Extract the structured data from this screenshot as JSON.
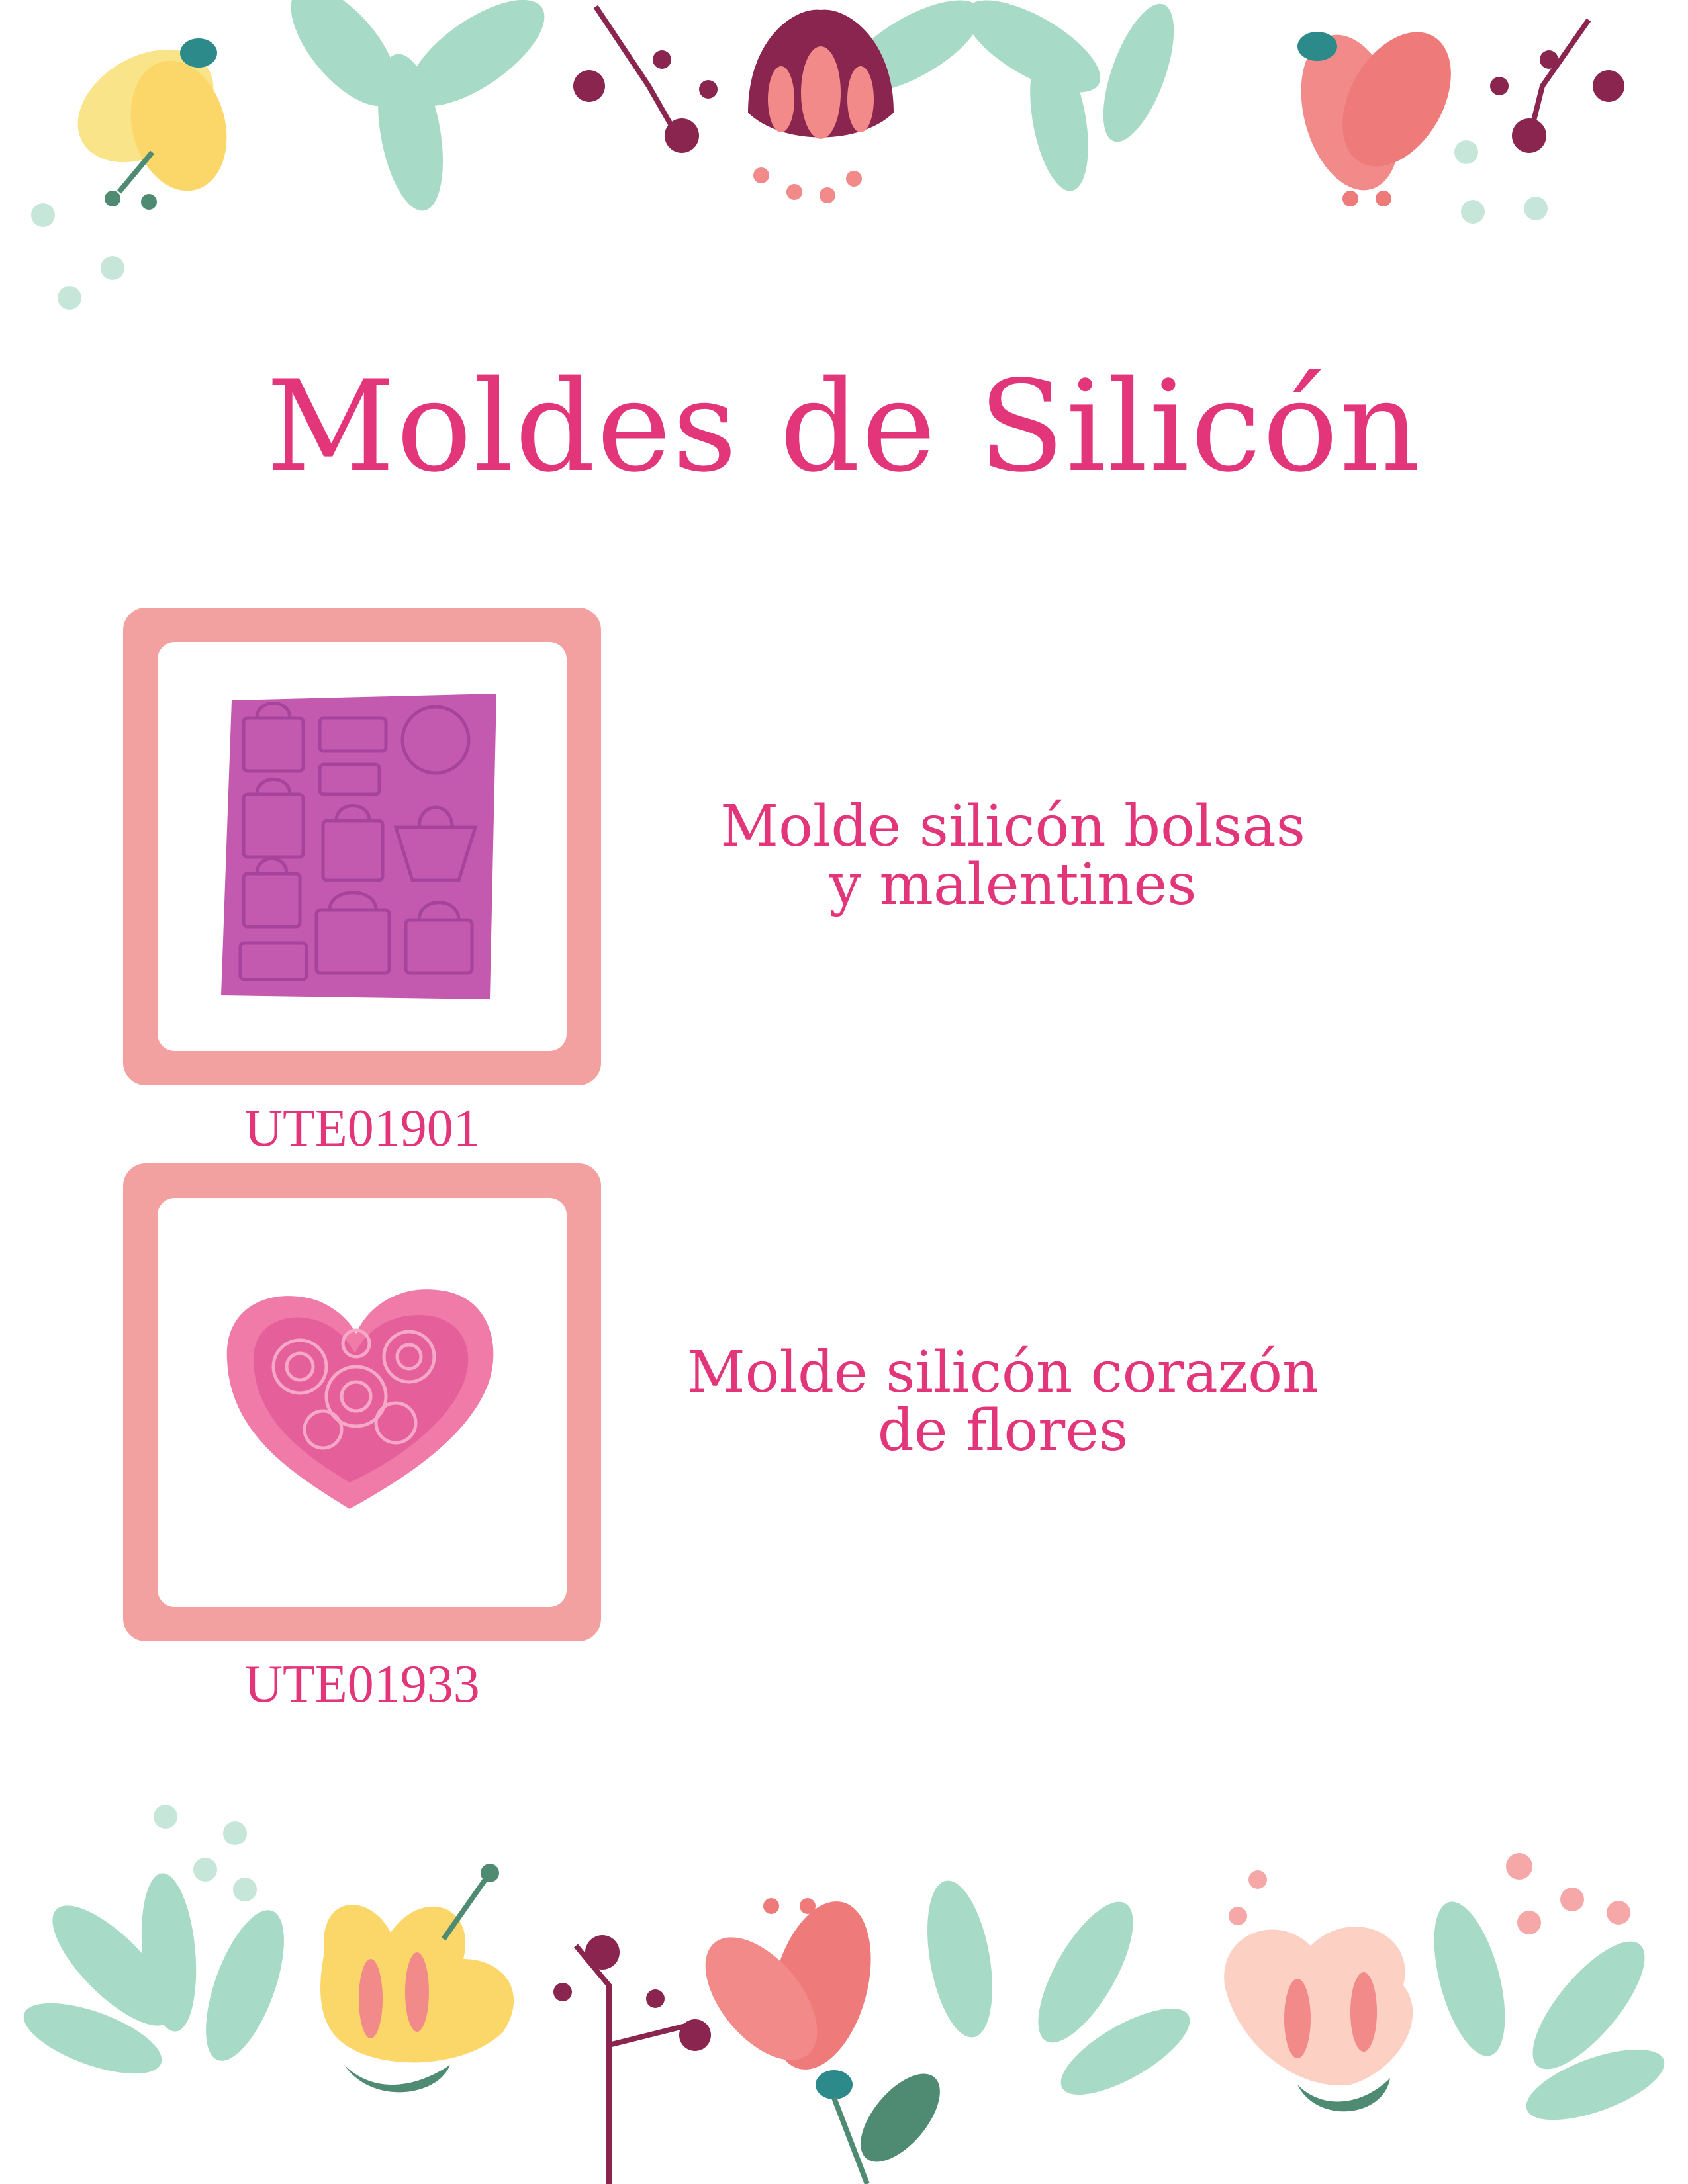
{
  "page_title": "Moldes de Silicón",
  "products": [
    {
      "code": "UTE01901",
      "name_line1": "Molde silicón bolsas",
      "name_line2": "y malentines",
      "image": "purple-bag-mold-image"
    },
    {
      "code": "UTE01933",
      "name_line1": "Molde silicón corazón",
      "name_line2": "de flores",
      "image": "pink-heart-flower-mold-image"
    }
  ],
  "colors": {
    "title": "#e3357a",
    "frame": "#f2a0a0",
    "mold_purple": "#c45ab0",
    "mold_pink": "#f07aa8",
    "leaf": "#a7dac7",
    "berry": "#8a2550"
  }
}
